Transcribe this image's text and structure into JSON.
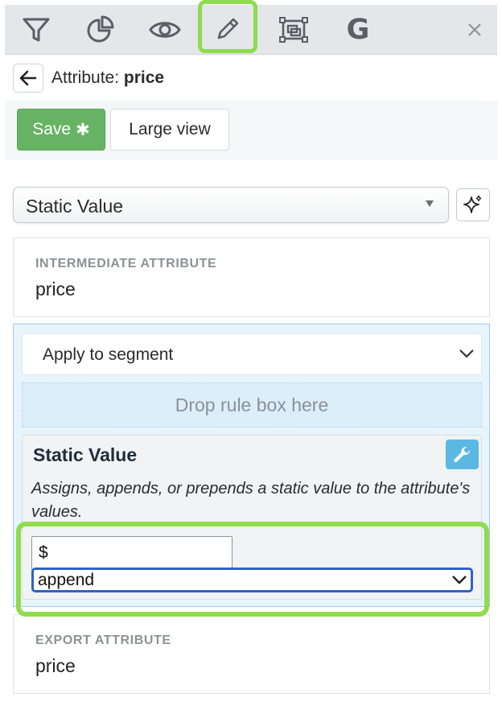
{
  "toolbar": {
    "icons": [
      "filter-icon",
      "pie-chart-icon",
      "eye-icon",
      "pencil-icon",
      "frame-icon",
      "google-icon",
      "close-icon"
    ],
    "google_letter": "G",
    "active": "pencil-icon",
    "highlight_color": "#8fdc4e"
  },
  "header": {
    "title_prefix": "Attribute: ",
    "title_name": "price"
  },
  "actions": {
    "save_label": "Save",
    "save_mark": "✱",
    "large_view_label": "Large view",
    "save_color": "#66b463"
  },
  "method_select": {
    "value": "Static Value"
  },
  "intermediate": {
    "label": "INTERMEDIATE ATTRIBUTE",
    "value": "price"
  },
  "segment": {
    "apply_label": "Apply to segment",
    "drop_zone_text": "Drop rule box here",
    "rule": {
      "title": "Static Value",
      "description": "Assigns, appends, or prepends a static value to the attribute's values.",
      "input_value": "$",
      "mode_value": "append"
    }
  },
  "export": {
    "label": "EXPORT ATTRIBUTE",
    "value": "price"
  }
}
